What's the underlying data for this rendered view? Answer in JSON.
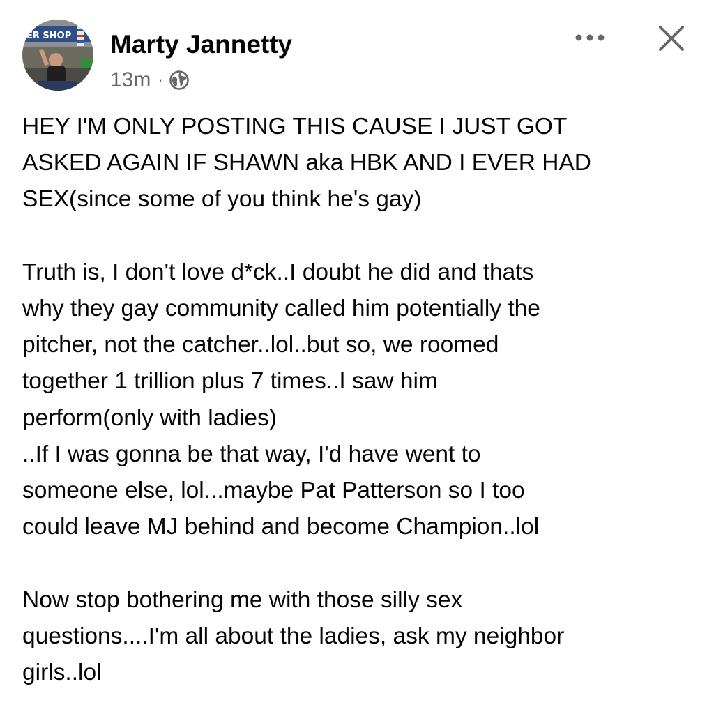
{
  "post": {
    "author": "Marty Jannetty",
    "timestamp": "13m",
    "separator": "·",
    "privacy_icon": "globe-icon",
    "avatar_sign_text": "ER SHOP",
    "header_actions": {
      "more_icon": "more-horizontal-icon",
      "close_icon": "close-icon"
    },
    "body": [
      "HEY I'M ONLY POSTING THIS CAUSE I JUST GOT",
      "ASKED AGAIN IF SHAWN aka HBK AND I EVER HAD",
      "SEX(since some of you think he's gay)",
      "",
      "Truth is, I don't love d*ck..I doubt he did and thats",
      "why they gay community called him potentially the",
      "pitcher, not the catcher..lol..but so, we roomed",
      "together 1 trillion plus 7 times..I saw him",
      "perform(only with ladies)",
      "..If I was gonna be that way, I'd have went to",
      "someone else, lol...maybe Pat Patterson so I too",
      "could leave MJ behind and become Champion..lol",
      "",
      "Now stop bothering me with those silly sex",
      "questions....I'm all about the ladies, ask my neighbor",
      "girls..lol"
    ]
  },
  "colors": {
    "text_primary": "#050505",
    "text_secondary": "#65676b",
    "background": "#ffffff"
  }
}
